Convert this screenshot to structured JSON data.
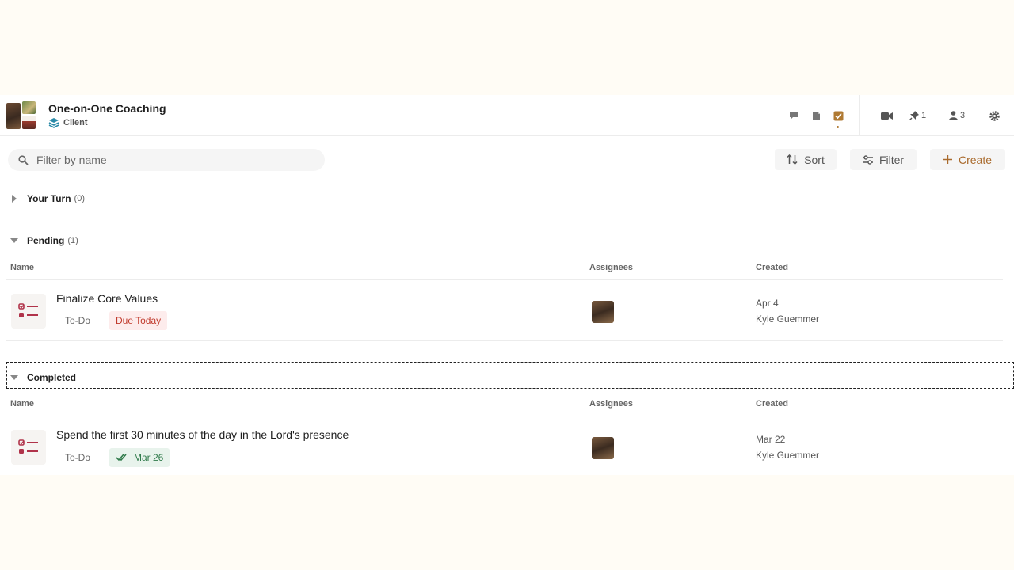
{
  "header": {
    "title": "One-on-One Coaching",
    "subtitle": "Client",
    "pins_count": "1",
    "members_count": "3"
  },
  "toolbar": {
    "search_placeholder": "Filter by name",
    "sort_label": "Sort",
    "filter_label": "Filter",
    "create_label": "Create"
  },
  "groups": {
    "your_turn": {
      "label": "Your Turn",
      "count": "(0)"
    },
    "pending": {
      "label": "Pending",
      "count": "(1)"
    },
    "completed": {
      "label": "Completed"
    }
  },
  "columns": {
    "name": "Name",
    "assignees": "Assignees",
    "created": "Created"
  },
  "pending_tasks": [
    {
      "name": "Finalize Core Values",
      "type": "To-Do",
      "status": "Due Today",
      "created_date": "Apr 4",
      "created_by": "Kyle Guemmer"
    }
  ],
  "completed_tasks": [
    {
      "name": "Spend the first 30 minutes of the day in the Lord's presence",
      "type": "To-Do",
      "completed_date": "Mar 26",
      "created_date": "Mar 22",
      "created_by": "Kyle Guemmer"
    }
  ],
  "colors": {
    "accent": "#a96a2c",
    "due": "#c0392b",
    "done": "#2f7a4a",
    "background": "#fffcf5"
  }
}
